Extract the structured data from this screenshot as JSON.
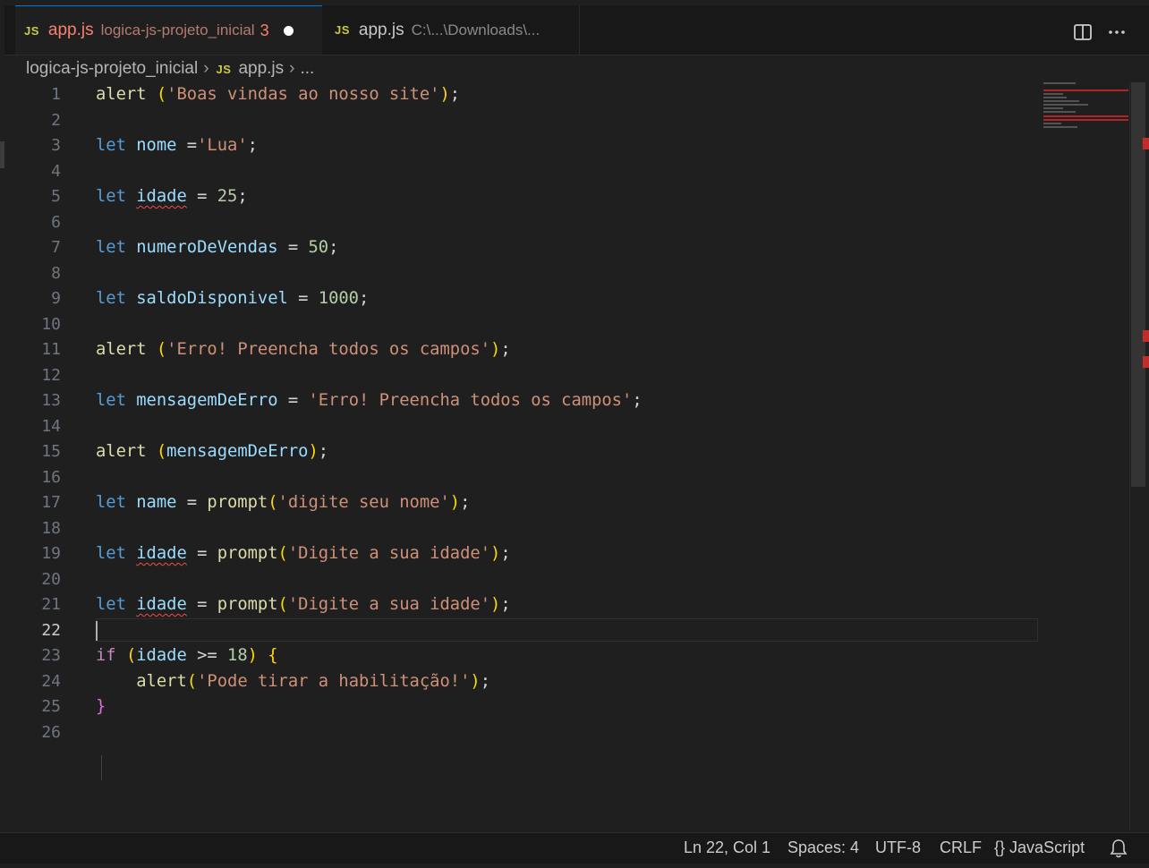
{
  "tabs": [
    {
      "label": "app.js",
      "description": "logica-js-projeto_inicial",
      "problems": "3",
      "icon": "JS",
      "active": true,
      "dirty": true
    },
    {
      "label": "app.js",
      "description": "C:\\...\\Downloads\\...",
      "icon": "JS",
      "active": false
    }
  ],
  "toolbar": {
    "split_icon": "split-editor-icon",
    "more_icon": "more-actions-icon"
  },
  "breadcrumb": {
    "folder": "logica-js-projeto_inicial",
    "file": "app.js",
    "symbol": "...",
    "icon": "JS"
  },
  "editor": {
    "active_line": 22,
    "line_numbers": [
      "1",
      "2",
      "3",
      "4",
      "5",
      "6",
      "7",
      "8",
      "9",
      "10",
      "11",
      "12",
      "13",
      "14",
      "15",
      "16",
      "17",
      "18",
      "19",
      "20",
      "21",
      "22",
      "23",
      "24",
      "25",
      "26"
    ],
    "lines": [
      "alert ('Boas vindas ao nosso site');",
      "",
      "let nome ='Lua';",
      "",
      "let idade = 25;",
      "",
      "let numeroDeVendas = 50;",
      "",
      "let saldoDisponivel = 1000;",
      "",
      "alert ('Erro! Preencha todos os campos');",
      "",
      "let mensagemDeErro = 'Erro! Preencha todos os campos';",
      "",
      "alert (mensagemDeErro);",
      "",
      "let name = prompt('digite seu nome');",
      "",
      "let idade = prompt('Digite a sua idade');",
      "",
      "let idade = prompt('Digite a sua idade');",
      "",
      "if (idade >= 18) {",
      "    alert('Pode tirar a habilitação!');",
      "}",
      ""
    ]
  },
  "status": {
    "position": "Ln 22, Col 1",
    "spaces": "Spaces: 4",
    "encoding": "UTF-8",
    "eol": "CRLF",
    "language_icon": "{}",
    "language": "JavaScript",
    "bell_icon": "bell-icon"
  },
  "colors": {
    "background": "#1f1f1f",
    "keyword": "#569cd6",
    "function": "#dcdcaa",
    "string": "#ce9178",
    "number": "#b5cea8",
    "variable": "#9cdcfe",
    "bracket": "#ffd700",
    "error": "#f14c4c",
    "tab_modified": "#f88070"
  }
}
